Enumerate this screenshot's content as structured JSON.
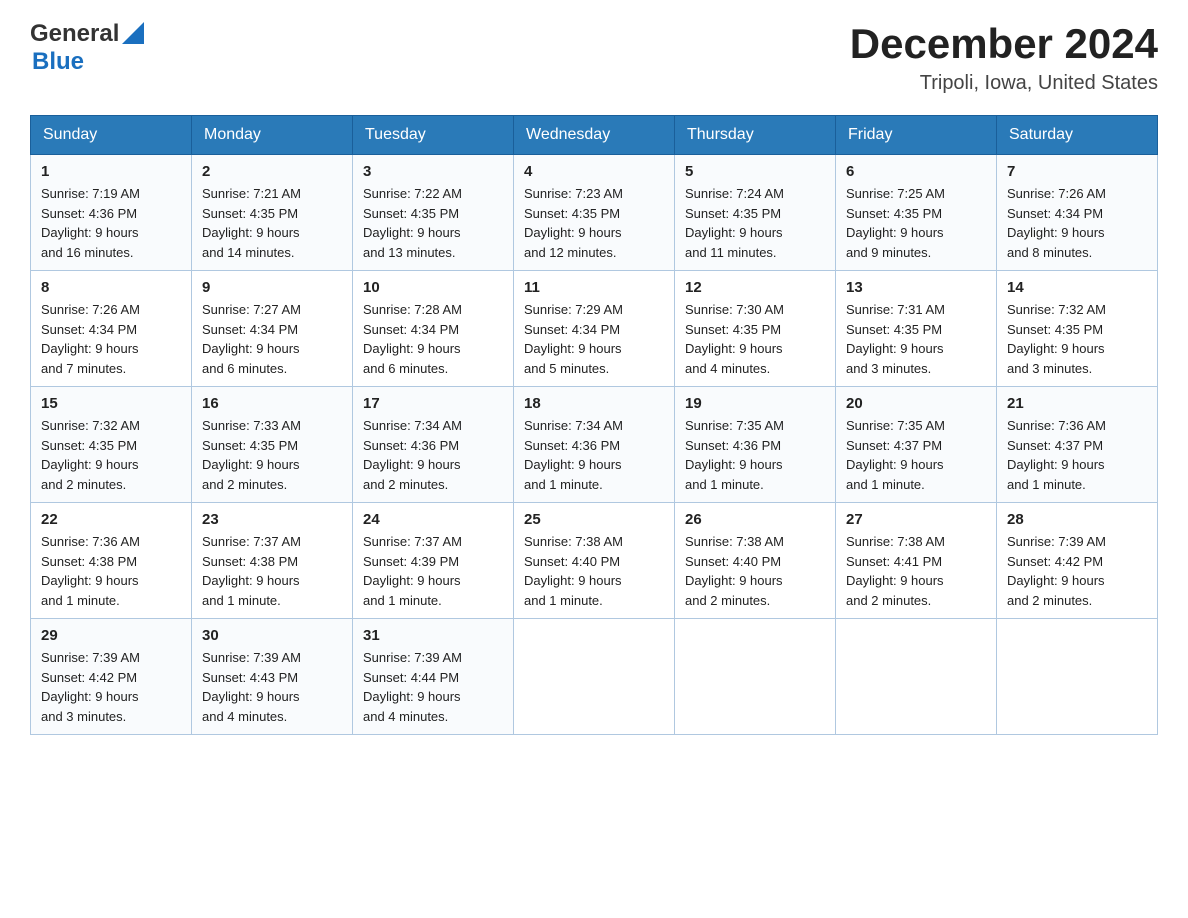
{
  "header": {
    "logo_general": "General",
    "logo_blue": "Blue",
    "month_title": "December 2024",
    "location": "Tripoli, Iowa, United States"
  },
  "days_of_week": [
    "Sunday",
    "Monday",
    "Tuesday",
    "Wednesday",
    "Thursday",
    "Friday",
    "Saturday"
  ],
  "weeks": [
    [
      {
        "day": "1",
        "sunrise": "7:19 AM",
        "sunset": "4:36 PM",
        "daylight": "9 hours and 16 minutes."
      },
      {
        "day": "2",
        "sunrise": "7:21 AM",
        "sunset": "4:35 PM",
        "daylight": "9 hours and 14 minutes."
      },
      {
        "day": "3",
        "sunrise": "7:22 AM",
        "sunset": "4:35 PM",
        "daylight": "9 hours and 13 minutes."
      },
      {
        "day": "4",
        "sunrise": "7:23 AM",
        "sunset": "4:35 PM",
        "daylight": "9 hours and 12 minutes."
      },
      {
        "day": "5",
        "sunrise": "7:24 AM",
        "sunset": "4:35 PM",
        "daylight": "9 hours and 11 minutes."
      },
      {
        "day": "6",
        "sunrise": "7:25 AM",
        "sunset": "4:35 PM",
        "daylight": "9 hours and 9 minutes."
      },
      {
        "day": "7",
        "sunrise": "7:26 AM",
        "sunset": "4:34 PM",
        "daylight": "9 hours and 8 minutes."
      }
    ],
    [
      {
        "day": "8",
        "sunrise": "7:26 AM",
        "sunset": "4:34 PM",
        "daylight": "9 hours and 7 minutes."
      },
      {
        "day": "9",
        "sunrise": "7:27 AM",
        "sunset": "4:34 PM",
        "daylight": "9 hours and 6 minutes."
      },
      {
        "day": "10",
        "sunrise": "7:28 AM",
        "sunset": "4:34 PM",
        "daylight": "9 hours and 6 minutes."
      },
      {
        "day": "11",
        "sunrise": "7:29 AM",
        "sunset": "4:34 PM",
        "daylight": "9 hours and 5 minutes."
      },
      {
        "day": "12",
        "sunrise": "7:30 AM",
        "sunset": "4:35 PM",
        "daylight": "9 hours and 4 minutes."
      },
      {
        "day": "13",
        "sunrise": "7:31 AM",
        "sunset": "4:35 PM",
        "daylight": "9 hours and 3 minutes."
      },
      {
        "day": "14",
        "sunrise": "7:32 AM",
        "sunset": "4:35 PM",
        "daylight": "9 hours and 3 minutes."
      }
    ],
    [
      {
        "day": "15",
        "sunrise": "7:32 AM",
        "sunset": "4:35 PM",
        "daylight": "9 hours and 2 minutes."
      },
      {
        "day": "16",
        "sunrise": "7:33 AM",
        "sunset": "4:35 PM",
        "daylight": "9 hours and 2 minutes."
      },
      {
        "day": "17",
        "sunrise": "7:34 AM",
        "sunset": "4:36 PM",
        "daylight": "9 hours and 2 minutes."
      },
      {
        "day": "18",
        "sunrise": "7:34 AM",
        "sunset": "4:36 PM",
        "daylight": "9 hours and 1 minute."
      },
      {
        "day": "19",
        "sunrise": "7:35 AM",
        "sunset": "4:36 PM",
        "daylight": "9 hours and 1 minute."
      },
      {
        "day": "20",
        "sunrise": "7:35 AM",
        "sunset": "4:37 PM",
        "daylight": "9 hours and 1 minute."
      },
      {
        "day": "21",
        "sunrise": "7:36 AM",
        "sunset": "4:37 PM",
        "daylight": "9 hours and 1 minute."
      }
    ],
    [
      {
        "day": "22",
        "sunrise": "7:36 AM",
        "sunset": "4:38 PM",
        "daylight": "9 hours and 1 minute."
      },
      {
        "day": "23",
        "sunrise": "7:37 AM",
        "sunset": "4:38 PM",
        "daylight": "9 hours and 1 minute."
      },
      {
        "day": "24",
        "sunrise": "7:37 AM",
        "sunset": "4:39 PM",
        "daylight": "9 hours and 1 minute."
      },
      {
        "day": "25",
        "sunrise": "7:38 AM",
        "sunset": "4:40 PM",
        "daylight": "9 hours and 1 minute."
      },
      {
        "day": "26",
        "sunrise": "7:38 AM",
        "sunset": "4:40 PM",
        "daylight": "9 hours and 2 minutes."
      },
      {
        "day": "27",
        "sunrise": "7:38 AM",
        "sunset": "4:41 PM",
        "daylight": "9 hours and 2 minutes."
      },
      {
        "day": "28",
        "sunrise": "7:39 AM",
        "sunset": "4:42 PM",
        "daylight": "9 hours and 2 minutes."
      }
    ],
    [
      {
        "day": "29",
        "sunrise": "7:39 AM",
        "sunset": "4:42 PM",
        "daylight": "9 hours and 3 minutes."
      },
      {
        "day": "30",
        "sunrise": "7:39 AM",
        "sunset": "4:43 PM",
        "daylight": "9 hours and 4 minutes."
      },
      {
        "day": "31",
        "sunrise": "7:39 AM",
        "sunset": "4:44 PM",
        "daylight": "9 hours and 4 minutes."
      },
      null,
      null,
      null,
      null
    ]
  ],
  "labels": {
    "sunrise": "Sunrise:",
    "sunset": "Sunset:",
    "daylight": "Daylight:"
  }
}
